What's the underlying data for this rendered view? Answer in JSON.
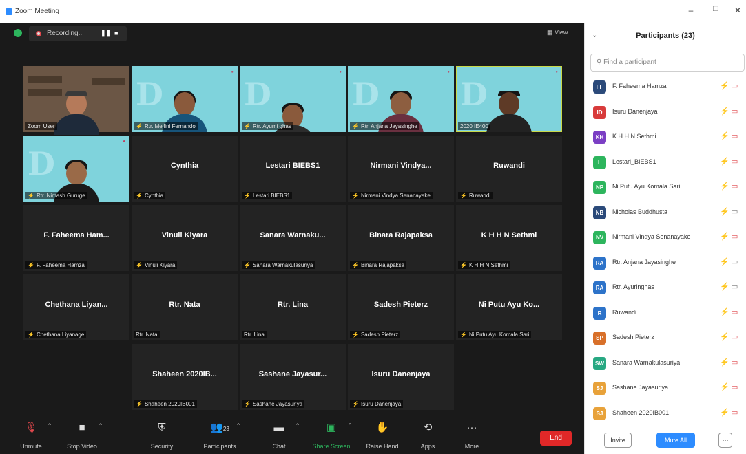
{
  "window": {
    "title": "Zoom Meeting",
    "minimize": "–",
    "restore": "❐",
    "close": "✕"
  },
  "topbar": {
    "recording_label": "Recording...",
    "pause": "❚❚",
    "stop": "■",
    "view_label": "View"
  },
  "gallery": {
    "row1": [
      {
        "label": "Zoom User"
      },
      {
        "label": "Rtr. Mellini Fernando"
      },
      {
        "label": "Rtr. Ayumi ghas"
      },
      {
        "label": "Rtr. Anjana Jayasinghe"
      },
      {
        "label": "2020 IE400"
      }
    ],
    "row2": [
      {
        "label": "Rtr. Nimash Guruge"
      },
      {
        "name": "Cynthia",
        "label": "Cynthia"
      },
      {
        "name": "Lestari BIEBS1",
        "label": "Lestari BIEBS1"
      },
      {
        "name": "Nirmani Vindya...",
        "label": "Nirmani Vindya Senanayake"
      },
      {
        "name": "Ruwandi",
        "label": "Ruwandi"
      }
    ],
    "row3": [
      {
        "name": "F. Faheema Ham...",
        "label": "F. Faheema Hamza"
      },
      {
        "name": "Vinuli Kiyara",
        "label": "Vinuli Kiyara"
      },
      {
        "name": "Sanara Warnaku...",
        "label": "Sanara Warnakulasuriya"
      },
      {
        "name": "Binara Rajapaksa",
        "label": "Binara Rajapaksa"
      },
      {
        "name": "K H H N Sethmi",
        "label": "K H H N Sethmi"
      }
    ],
    "row4": [
      {
        "name": "Chethana Liyan...",
        "label": "Chethana Liyanage"
      },
      {
        "name": "Rtr. Nata",
        "label": "Rtr. Nata"
      },
      {
        "name": "Rtr. Lina",
        "label": "Rtr. Lina"
      },
      {
        "name": "Sadesh Pieterz",
        "label": "Sadesh Pieterz"
      },
      {
        "name": "Ni Putu Ayu Ko...",
        "label": "Ni Putu Ayu Komala Sari"
      }
    ],
    "row5": [
      {
        "name": "Shaheen 2020IB...",
        "label": "Shaheen 2020IB001"
      },
      {
        "name": "Sashane Jayasur...",
        "label": "Sashane Jayasuriya"
      },
      {
        "name": "Isuru Danenjaya",
        "label": "Isuru Danenjaya"
      }
    ]
  },
  "toolbar": {
    "unmute": "Unmute",
    "stop_video": "Stop Video",
    "security": "Security",
    "participants": "Participants",
    "participants_count": "23",
    "chat": "Chat",
    "share_screen": "Share Screen",
    "raise_hand": "Raise Hand",
    "apps": "Apps",
    "more": "More",
    "end": "End",
    "caret": "^"
  },
  "panel": {
    "title": "Participants (23)",
    "search_placeholder": "Find a participant",
    "participants": [
      {
        "initials": "FF",
        "name": "F. Faheema Hamza",
        "color": "#2b4a7a",
        "cam": "off"
      },
      {
        "initials": "ID",
        "name": "Isuru Danenjaya",
        "color": "#d83b3b",
        "cam": "off"
      },
      {
        "initials": "KH",
        "name": "K H H N Sethmi",
        "color": "#7b3fc4",
        "cam": "off"
      },
      {
        "initials": "L",
        "name": "Lestari_BIEBS1",
        "color": "#2db55d",
        "cam": "off"
      },
      {
        "initials": "NP",
        "name": "Ni Putu Ayu Komala Sari",
        "color": "#2db55d",
        "cam": "off"
      },
      {
        "initials": "NB",
        "name": "Nicholas Buddhusta",
        "color": "#2b4a7a",
        "cam": "on"
      },
      {
        "initials": "NV",
        "name": "Nirmani Vindya Senanayake",
        "color": "#2db55d",
        "cam": "off"
      },
      {
        "initials": "RA",
        "name": "Rtr. Anjana Jayasinghe",
        "color": "#2d73c9",
        "cam": "on"
      },
      {
        "initials": "RA",
        "name": "Rtr. Ayuringhas",
        "color": "#2d73c9",
        "cam": "on"
      },
      {
        "initials": "R",
        "name": "Ruwandi",
        "color": "#2d73c9",
        "cam": "off"
      },
      {
        "initials": "SP",
        "name": "Sadesh Pieterz",
        "color": "#d8702a",
        "cam": "off"
      },
      {
        "initials": "SW",
        "name": "Sanara Warnakulasuriya",
        "color": "#27a882",
        "cam": "off"
      },
      {
        "initials": "SJ",
        "name": "Sashane Jayasuriya",
        "color": "#e8a23a",
        "cam": "off"
      },
      {
        "initials": "SJ",
        "name": "Shaheen 2020IB001",
        "color": "#e8a23a",
        "cam": "off"
      }
    ],
    "invite": "Invite",
    "mute_all": "Mute All",
    "more": "···"
  },
  "colors": {
    "accent": "#2d8cff",
    "end": "#e02828",
    "muted": "#e0474c",
    "active_speaker": "#c8d94a"
  }
}
